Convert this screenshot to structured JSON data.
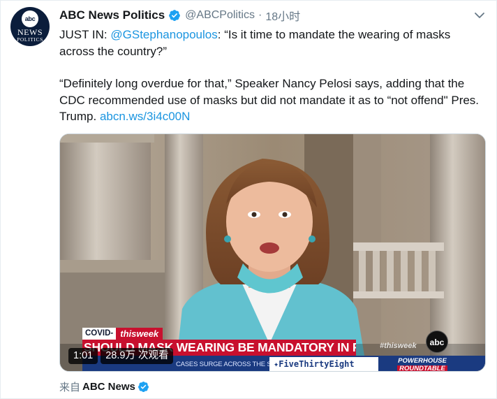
{
  "tweet": {
    "display_name": "ABC News Politics",
    "verified_icon": "verified-badge-icon",
    "handle": "@ABCPolitics",
    "separator": "·",
    "time": "18小时",
    "avatar": {
      "logo": "abc",
      "line1": "NEWS",
      "line2": "POLITICS"
    },
    "text": {
      "p1_prefix": "JUST IN: ",
      "p1_mention": "@GStephanopoulos",
      "p1_rest": ": “Is it time to mandate the wearing of masks across the country?”",
      "p2_text": "“Definitely long overdue for that,” Speaker Nancy Pelosi says, adding that the CDC recommended use of masks but did not mandate it as to “not offend\" Pres. Trump. ",
      "p2_link": "abcn.ws/3i4c00N"
    },
    "media": {
      "chyron_tag_left": "COVID-",
      "chyron_tag_right": "thisweek",
      "chyron_headline": "SHOULD MASK WEARING BE MANDATORY IN PUBLIC?",
      "chyron_cases": "CASES SURGE ACROSS THE SOUTH",
      "chyron_fte": "FiveThirtyEight",
      "chyron_powerhouse_1": "POWERHOUSE",
      "chyron_powerhouse_2": "ROUNDTABLE",
      "watermark": "#thisweek",
      "network_logo": "abc",
      "duration": "1:01",
      "views": "28.9万 次观看"
    },
    "source": {
      "prefix": "来自",
      "app": "ABC News"
    }
  },
  "colors": {
    "accent": "#1b95e0",
    "verified": "#1da1f2",
    "secondary_text": "#657786",
    "chyron_red": "#c8102e",
    "chyron_blue": "#1a3a80"
  }
}
